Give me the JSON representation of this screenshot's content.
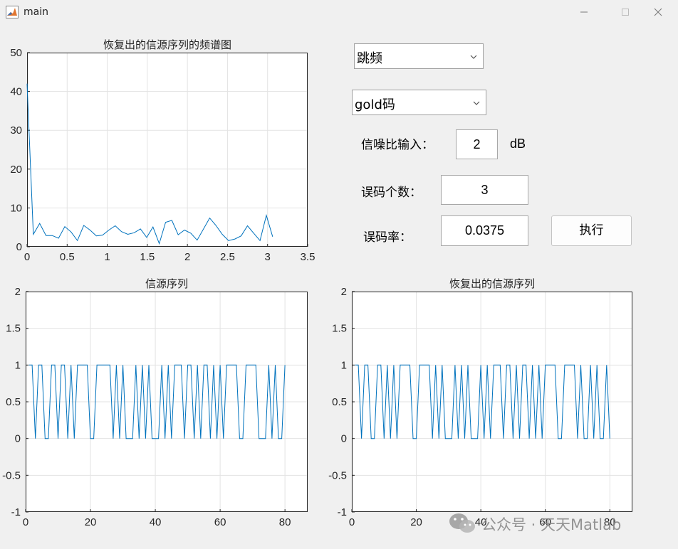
{
  "window": {
    "title": "main"
  },
  "controls": {
    "mode_select": "跳频",
    "code_select": "gold码",
    "snr_label": "信噪比输入：",
    "snr_value": "2",
    "snr_unit": "dB",
    "err_count_label": "误码个数：",
    "err_count_value": "3",
    "ber_label": "误码率：",
    "ber_value": "0.0375",
    "run_label": "执行"
  },
  "watermark": {
    "text": "公众号 · 天天Matlab"
  },
  "chart_data": [
    {
      "type": "line",
      "title": "恢复出的信源序列的频谱图",
      "xlim": [
        0,
        3.5
      ],
      "ylim": [
        0,
        50
      ],
      "xticks": [
        "0",
        "0.5",
        "1",
        "1.5",
        "2",
        "2.5",
        "3",
        "3.5"
      ],
      "yticks": [
        "0",
        "10",
        "20",
        "30",
        "40",
        "50"
      ],
      "grid": true,
      "color": "#0072bd",
      "x": [
        0,
        0.0785,
        0.157,
        0.236,
        0.314,
        0.393,
        0.471,
        0.55,
        0.628,
        0.707,
        0.785,
        0.864,
        0.942,
        1.021,
        1.1,
        1.178,
        1.257,
        1.335,
        1.414,
        1.492,
        1.571,
        1.649,
        1.728,
        1.806,
        1.885,
        1.963,
        2.042,
        2.121,
        2.199,
        2.278,
        2.356,
        2.435,
        2.513,
        2.592,
        2.67,
        2.749,
        2.827,
        2.906,
        2.985,
        3.063
      ],
      "y": [
        42,
        3.2,
        6,
        2.9,
        2.9,
        2.2,
        5.2,
        3.8,
        1.6,
        5.5,
        4.3,
        2.8,
        3,
        4.3,
        5.4,
        3.9,
        3.2,
        3.6,
        4.6,
        2.4,
        5.1,
        0.8,
        6.3,
        6.8,
        3.1,
        4.3,
        3.5,
        1.7,
        4.5,
        7.4,
        5.5,
        3.2,
        1.6,
        2,
        2.8,
        5.4,
        3.5,
        1.6,
        8.1,
        2.6
      ]
    },
    {
      "type": "line",
      "title": "信源序列",
      "xlim": [
        0,
        87
      ],
      "ylim": [
        -1,
        2
      ],
      "xticks": [
        "0",
        "20",
        "40",
        "60",
        "80"
      ],
      "yticks": [
        "-1",
        "-0.5",
        "0",
        "0.5",
        "1",
        "1.5",
        "2"
      ],
      "grid": true,
      "color": "#0072bd",
      "x": [
        1,
        2,
        3,
        4,
        5,
        6,
        7,
        8,
        9,
        10,
        11,
        12,
        13,
        14,
        15,
        16,
        17,
        18,
        19,
        20,
        21,
        22,
        23,
        24,
        25,
        26,
        27,
        28,
        29,
        30,
        31,
        32,
        33,
        34,
        35,
        36,
        37,
        38,
        39,
        40,
        41,
        42,
        43,
        44,
        45,
        46,
        47,
        48,
        49,
        50,
        51,
        52,
        53,
        54,
        55,
        56,
        57,
        58,
        59,
        60,
        61,
        62,
        63,
        64,
        65,
        66,
        67,
        68,
        69,
        70,
        71,
        72,
        73,
        74,
        75,
        76,
        77,
        78,
        79,
        80
      ],
      "y": [
        1,
        1,
        0,
        1,
        1,
        0,
        0,
        1,
        1,
        0,
        1,
        1,
        0,
        1,
        0,
        1,
        1,
        1,
        1,
        0,
        0,
        1,
        1,
        1,
        1,
        1,
        0,
        1,
        0,
        1,
        0,
        0,
        0,
        1,
        0,
        1,
        0,
        1,
        0,
        0,
        0,
        1,
        0,
        1,
        0,
        1,
        1,
        1,
        0,
        1,
        1,
        0,
        1,
        0,
        1,
        1,
        0,
        1,
        0,
        1,
        0,
        1,
        1,
        1,
        1,
        0,
        0,
        1,
        1,
        1,
        1,
        0,
        0,
        0,
        1,
        0,
        1,
        0,
        0,
        1
      ]
    },
    {
      "type": "line",
      "title": "恢复出的信源序列",
      "xlim": [
        0,
        87
      ],
      "ylim": [
        -1,
        2
      ],
      "xticks": [
        "0",
        "20",
        "40",
        "60",
        "80"
      ],
      "yticks": [
        "-1",
        "-0.5",
        "0",
        "0.5",
        "1",
        "1.5",
        "2"
      ],
      "grid": true,
      "color": "#0072bd",
      "x": [
        1,
        2,
        3,
        4,
        5,
        6,
        7,
        8,
        9,
        10,
        11,
        12,
        13,
        14,
        15,
        16,
        17,
        18,
        19,
        20,
        21,
        22,
        23,
        24,
        25,
        26,
        27,
        28,
        29,
        30,
        31,
        32,
        33,
        34,
        35,
        36,
        37,
        38,
        39,
        40,
        41,
        42,
        43,
        44,
        45,
        46,
        47,
        48,
        49,
        50,
        51,
        52,
        53,
        54,
        55,
        56,
        57,
        58,
        59,
        60,
        61,
        62,
        63,
        64,
        65,
        66,
        67,
        68,
        69,
        70,
        71,
        72,
        73,
        74,
        75,
        76,
        77,
        78,
        79,
        80
      ],
      "y": [
        1,
        1,
        0,
        1,
        1,
        0,
        0,
        1,
        1,
        0,
        1,
        0,
        1,
        0,
        1,
        1,
        1,
        1,
        0,
        0,
        1,
        1,
        1,
        1,
        0,
        1,
        0,
        1,
        0,
        0,
        0,
        1,
        0,
        1,
        0,
        1,
        0,
        0,
        0,
        1,
        0,
        1,
        0,
        1,
        1,
        1,
        0,
        1,
        1,
        0,
        1,
        0,
        1,
        1,
        0,
        1,
        0,
        1,
        0,
        1,
        1,
        1,
        1,
        0,
        0,
        1,
        1,
        1,
        1,
        0,
        1,
        0,
        0,
        1,
        0,
        1,
        0,
        0,
        1,
        0
      ]
    }
  ]
}
